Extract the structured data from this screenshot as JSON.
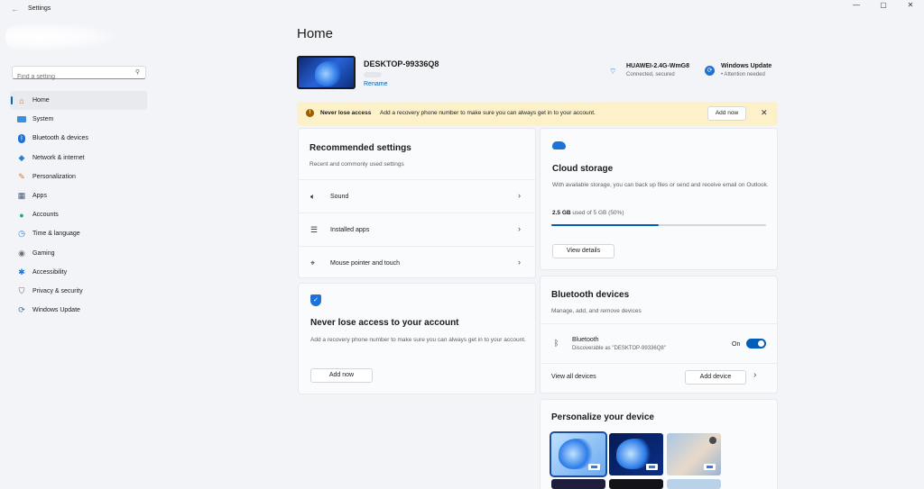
{
  "window": {
    "title": "Settings",
    "controls": [
      "—",
      "▢",
      "✕"
    ]
  },
  "sidebar": {
    "search_placeholder": "Find a setting",
    "items": [
      {
        "label": "Home",
        "icon": "home-icon",
        "color": "#c66a34"
      },
      {
        "label": "System",
        "icon": "system-icon",
        "color": "#3b8fe0"
      },
      {
        "label": "Bluetooth & devices",
        "icon": "bluetooth-icon",
        "color": "#1d74d6"
      },
      {
        "label": "Network & internet",
        "icon": "network-icon",
        "color": "#2b7fd8"
      },
      {
        "label": "Personalization",
        "icon": "brush-icon",
        "color": "#d9762b"
      },
      {
        "label": "Apps",
        "icon": "apps-icon",
        "color": "#4b5a77"
      },
      {
        "label": "Accounts",
        "icon": "accounts-icon",
        "color": "#2ea37f"
      },
      {
        "label": "Time & language",
        "icon": "time-language-icon",
        "color": "#2b7fd8"
      },
      {
        "label": "Gaming",
        "icon": "gaming-icon",
        "color": "#6b6f78"
      },
      {
        "label": "Accessibility",
        "icon": "accessibility-icon",
        "color": "#1d74d6"
      },
      {
        "label": "Privacy & security",
        "icon": "shield-icon",
        "color": "#6b6f78"
      },
      {
        "label": "Windows Update",
        "icon": "windows-update-icon",
        "color": "#1d74d6"
      }
    ]
  },
  "main": {
    "title": "Home",
    "device": {
      "name": "DESKTOP-99336Q8",
      "rename_label": "Rename"
    },
    "network": {
      "name": "HUAWEI-2.4G-WmG8",
      "status": "Connected, secured"
    },
    "update": {
      "name": "Windows Update",
      "status": "• Attention needed"
    },
    "banner": {
      "title": "Never lose access",
      "message": "Add a recovery phone number to make sure you can always get in to your account.",
      "button": "Add now"
    },
    "recommended": {
      "title": "Recommended settings",
      "subtitle": "Recent and commonly used settings",
      "items": [
        {
          "label": "Sound",
          "icon": "speaker-icon"
        },
        {
          "label": "Installed apps",
          "icon": "list-icon"
        },
        {
          "label": "Mouse pointer and touch",
          "icon": "mouse-pointer-icon"
        }
      ]
    },
    "account_card": {
      "title": "Never lose access to your account",
      "description": "Add a recovery phone number to make sure you can always get in to your account.",
      "button": "Add now"
    },
    "cloud": {
      "title": "Cloud storage",
      "description": "With available storage, you can back up files or send and receive email on Outlook.",
      "used": "2.5 GB",
      "usage_text": "used of 5 GB (50%)",
      "percent": 50,
      "button": "View details"
    },
    "bluetooth": {
      "title": "Bluetooth devices",
      "subtitle": "Manage, add, and remove devices",
      "device_label": "Bluetooth",
      "device_status": "Discoverable as \"DESKTOP-99336Q8\"",
      "toggle_state": "On",
      "view_all": "View all devices",
      "add_button": "Add device"
    },
    "personalize": {
      "title": "Personalize your device"
    }
  }
}
